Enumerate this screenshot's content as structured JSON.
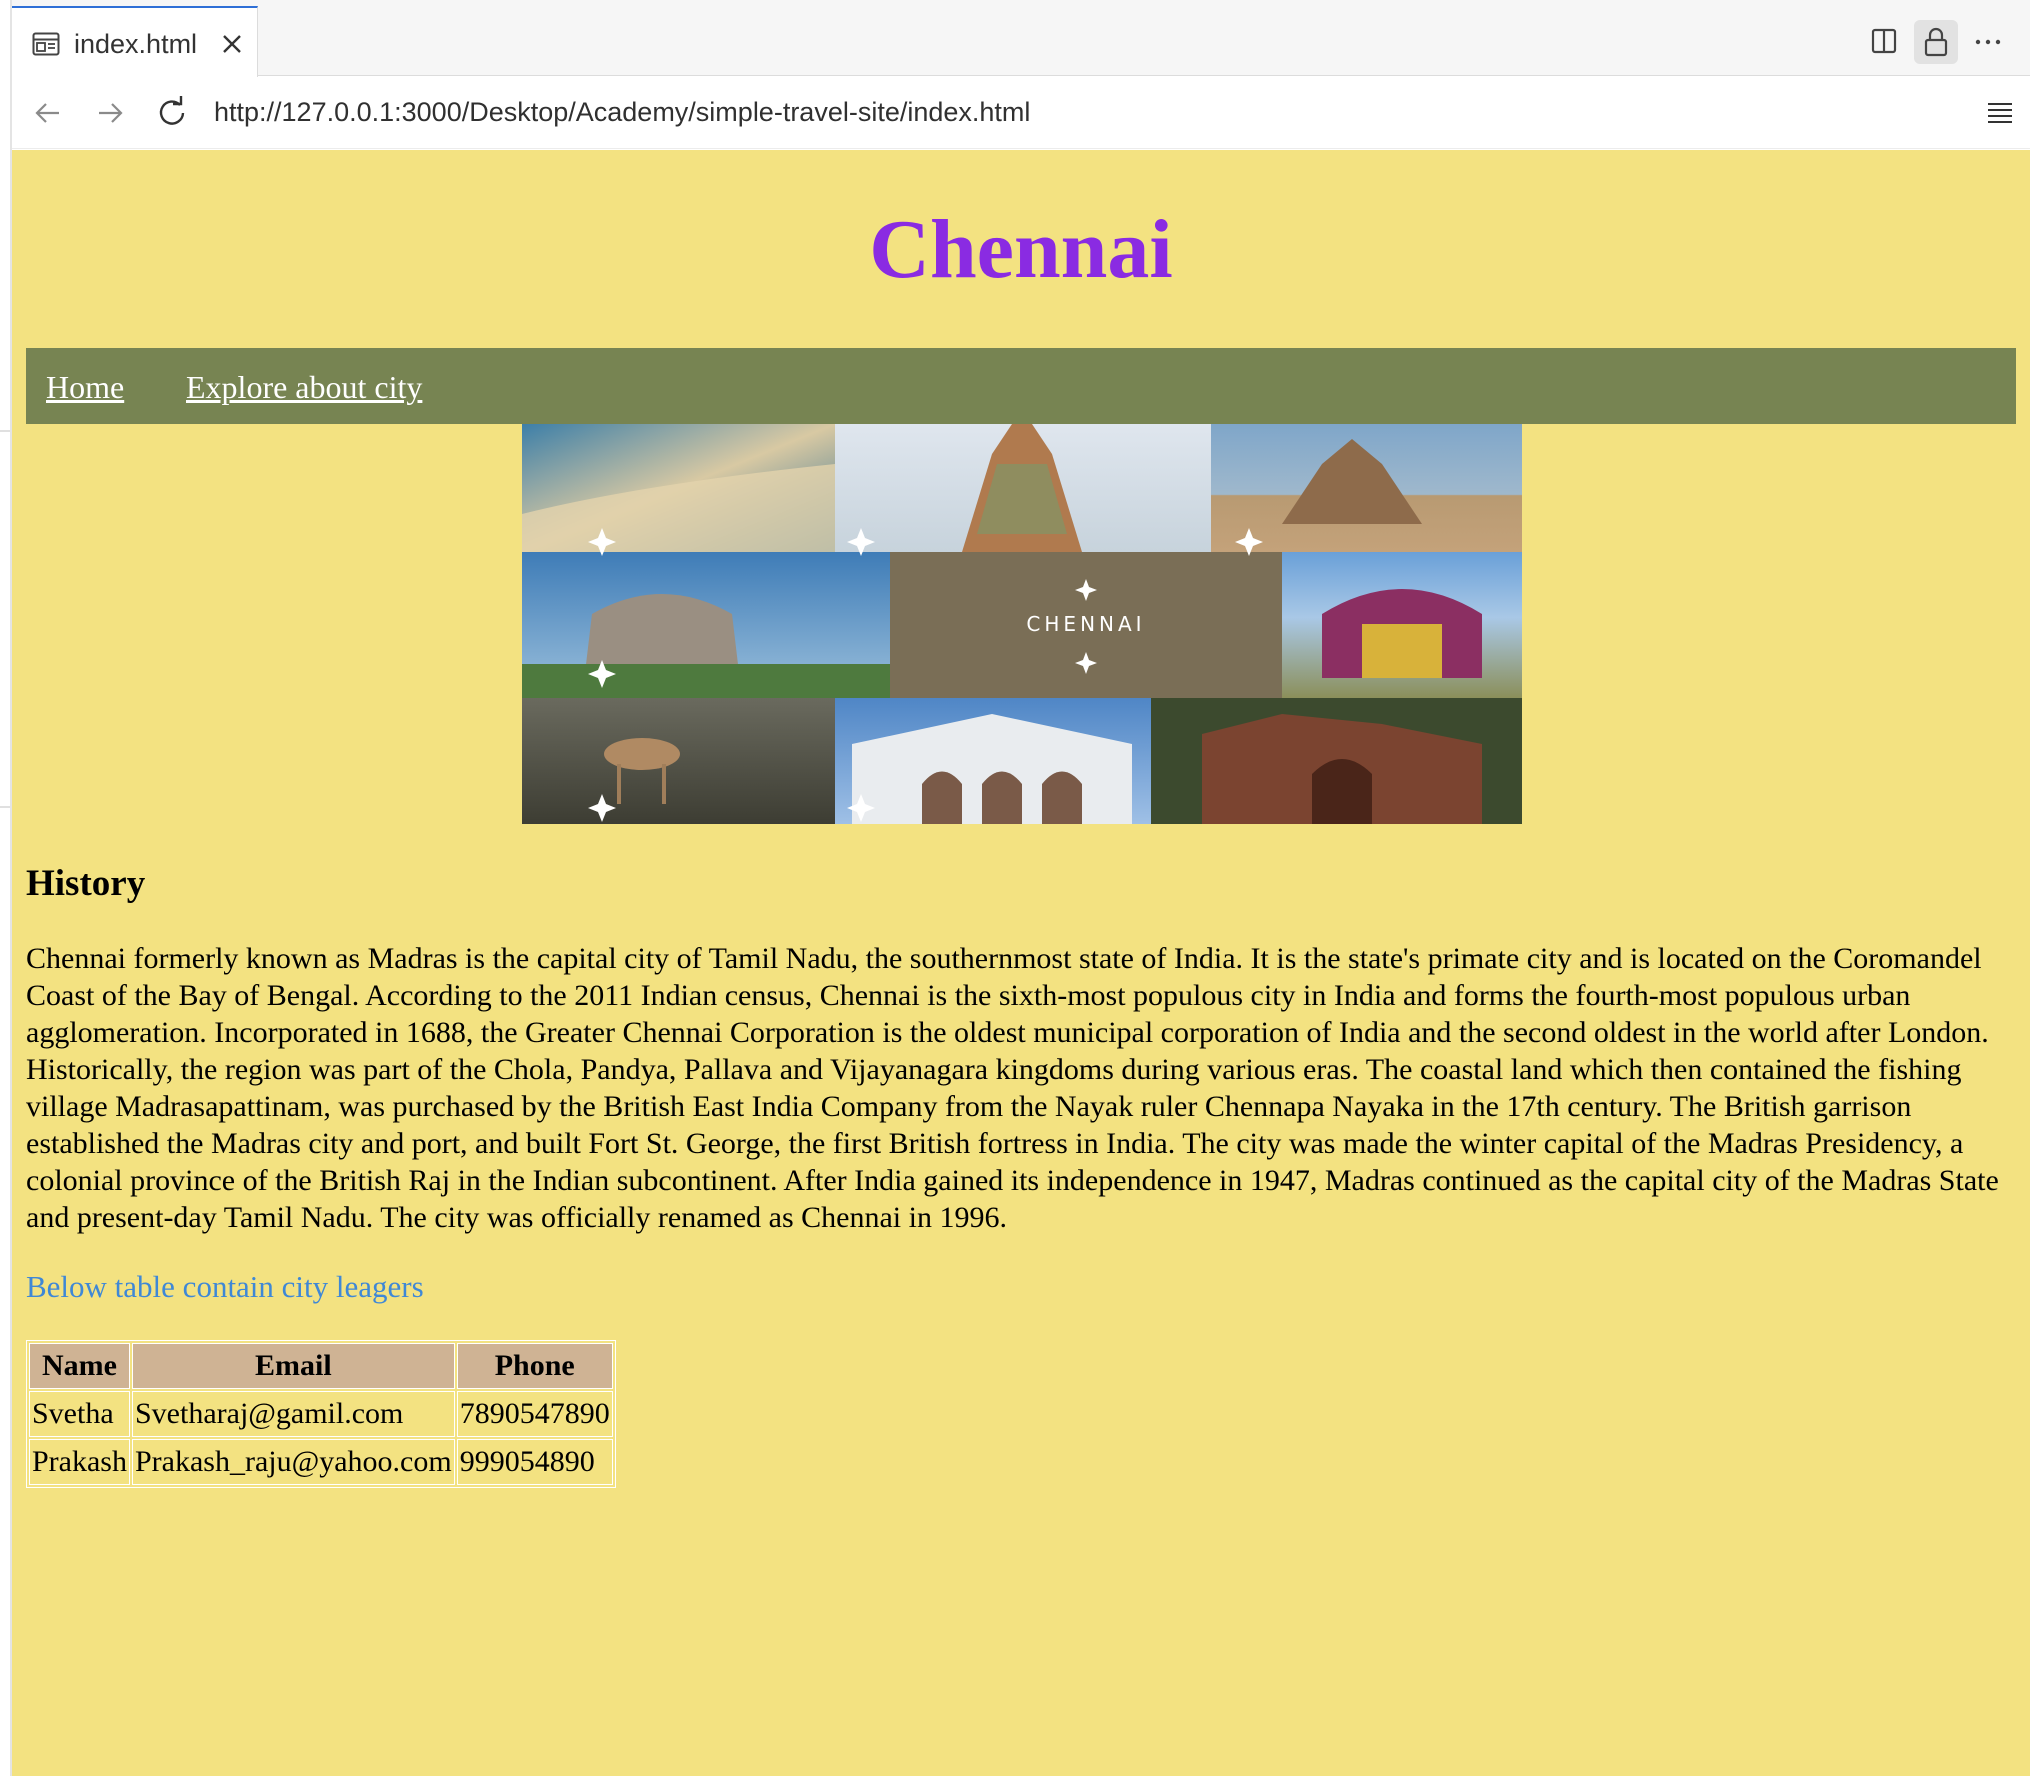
{
  "browser": {
    "tab": {
      "title": "index.html"
    },
    "url": "http://127.0.0.1:3000/Desktop/Academy/simple-travel-site/index.html"
  },
  "page": {
    "title": "Chennai",
    "nav": [
      {
        "label": "Home"
      },
      {
        "label": "Explore about city"
      }
    ],
    "collage": {
      "caption": "CHENNAI",
      "tiles": [
        "beach",
        "temple-gopuram",
        "shore-temple",
        "stone-chariot",
        "caption-panel",
        "palace",
        "deer",
        "church",
        "brick-fort"
      ]
    },
    "history": {
      "heading": "History",
      "text": "Chennai formerly known as Madras is the capital city of Tamil Nadu, the southernmost state of India. It is the state's primate city and is located on the Coromandel Coast of the Bay of Bengal. According to the 2011 Indian census, Chennai is the sixth-most populous city in India and forms the fourth-most populous urban agglomeration. Incorporated in 1688, the Greater Chennai Corporation is the oldest municipal corporation of India and the second oldest in the world after London. Historically, the region was part of the Chola, Pandya, Pallava and Vijayanagara kingdoms during various eras. The coastal land which then contained the fishing village Madrasapattinam, was purchased by the British East India Company from the Nayak ruler Chennapa Nayaka in the 17th century. The British garrison established the Madras city and port, and built Fort St. George, the first British fortress in India. The city was made the winter capital of the Madras Presidency, a colonial province of the British Raj in the Indian subcontinent. After India gained its independence in 1947, Madras continued as the capital city of the Madras State and present-day Tamil Nadu. The city was officially renamed as Chennai in 1996."
    },
    "table_note": "Below table contain city leagers",
    "table": {
      "headers": [
        "Name",
        "Email",
        "Phone"
      ],
      "rows": [
        [
          "Svetha",
          "Svetharaj@gamil.com",
          "7890547890"
        ],
        [
          "Prakash",
          "Prakash_raju@yahoo.com",
          "999054890"
        ]
      ]
    }
  },
  "colors": {
    "page_background": "#f3e281",
    "title": "#8a2be2",
    "navbar": "#778452",
    "note": "#3f88d6",
    "table_header": "#cfb394"
  },
  "icons": {
    "tab": "page-icon",
    "close": "close-icon",
    "split": "split-view-icon",
    "lock": "lock-icon",
    "more": "more-icon",
    "back": "back-arrow-icon",
    "forward": "forward-arrow-icon",
    "reload": "reload-icon",
    "reader": "reader-mode-icon"
  }
}
